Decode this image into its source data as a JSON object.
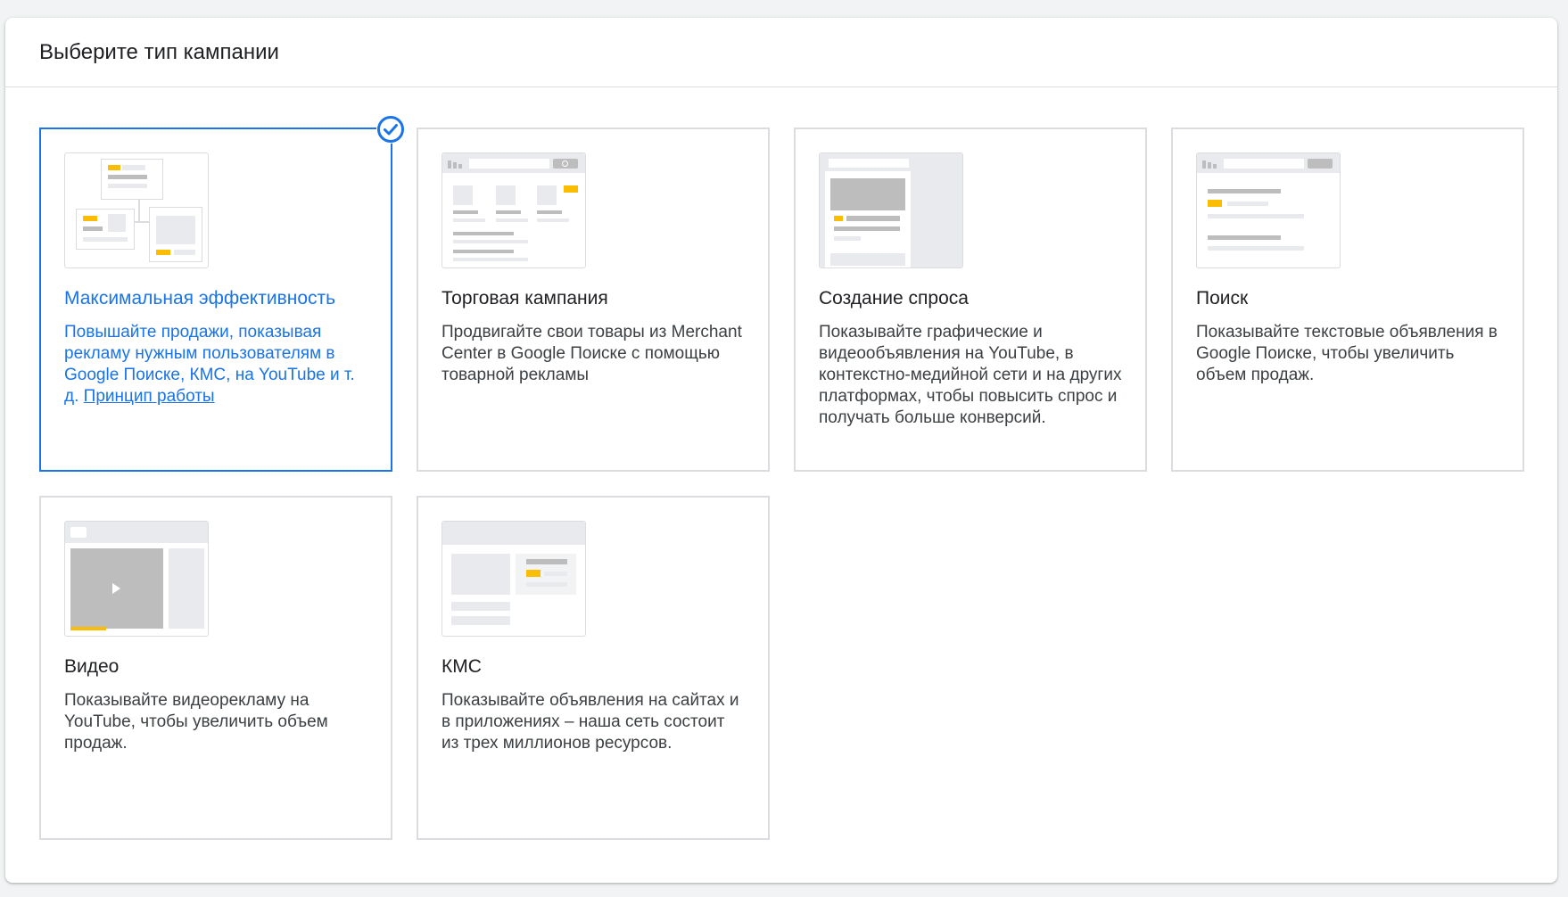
{
  "header": {
    "title": "Выберите тип кампании"
  },
  "cards": [
    {
      "title": "Максимальная эффективность",
      "desc": "Повышайте продажи, показывая рекламу нужным пользователям в Google Поиске, КМС, на YouTube и т. д.",
      "link": "Принцип работы",
      "selected": true
    },
    {
      "title": "Торговая кампания",
      "desc": "Продвигайте свои товары из Merchant Center в Google Поиске с помощью товарной рекламы"
    },
    {
      "title": "Создание спроса",
      "desc": "Показывайте графические и видеообъявления на YouTube, в контекстно-медийной сети и на других платформах, чтобы повысить спрос и получать больше конверсий."
    },
    {
      "title": "Поиск",
      "desc": "Показывайте текстовые объявления в Google Поиске, чтобы увеличить объем продаж."
    },
    {
      "title": "Видео",
      "desc": "Показывайте видеорекламу на YouTube, чтобы увеличить объем продаж."
    },
    {
      "title": "КМС",
      "desc": "Показывайте объявления на сайтах и в приложениях – наша сеть состоит из трех миллионов ресурсов."
    }
  ],
  "colors": {
    "accent": "#1a73e8",
    "highlight": "#fbbc04",
    "border": "#dadce0"
  },
  "icons": {
    "selected": "check-circle-icon",
    "play": "play-icon",
    "search": "search-icon"
  }
}
